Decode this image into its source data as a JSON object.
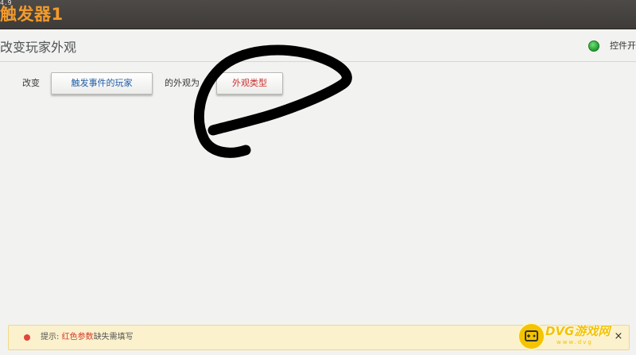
{
  "header": {
    "version": "4.9",
    "trigger_title": "触发器1"
  },
  "section": {
    "title": "改变玩家外观",
    "toggle_label": "控件开"
  },
  "action": {
    "prefix": "改变",
    "target_button": "触发事件的玩家",
    "middle": "的外观为",
    "appearance_button": "外观类型"
  },
  "hint": {
    "prefix": "提示: ",
    "red_part": "红色参数",
    "suffix": "缺失需填写",
    "close": "×"
  },
  "watermark": {
    "text": "DVG游戏网",
    "sub": "www.dvg"
  },
  "colors": {
    "header_bg": "#45423f",
    "title_orange": "#f39a2b",
    "status_green": "#2fb53c",
    "hint_bg": "#fbf1cc",
    "hint_red": "#d33a2f",
    "button_blue_text": "#1f5ea8",
    "button_red_text": "#c9302c"
  }
}
